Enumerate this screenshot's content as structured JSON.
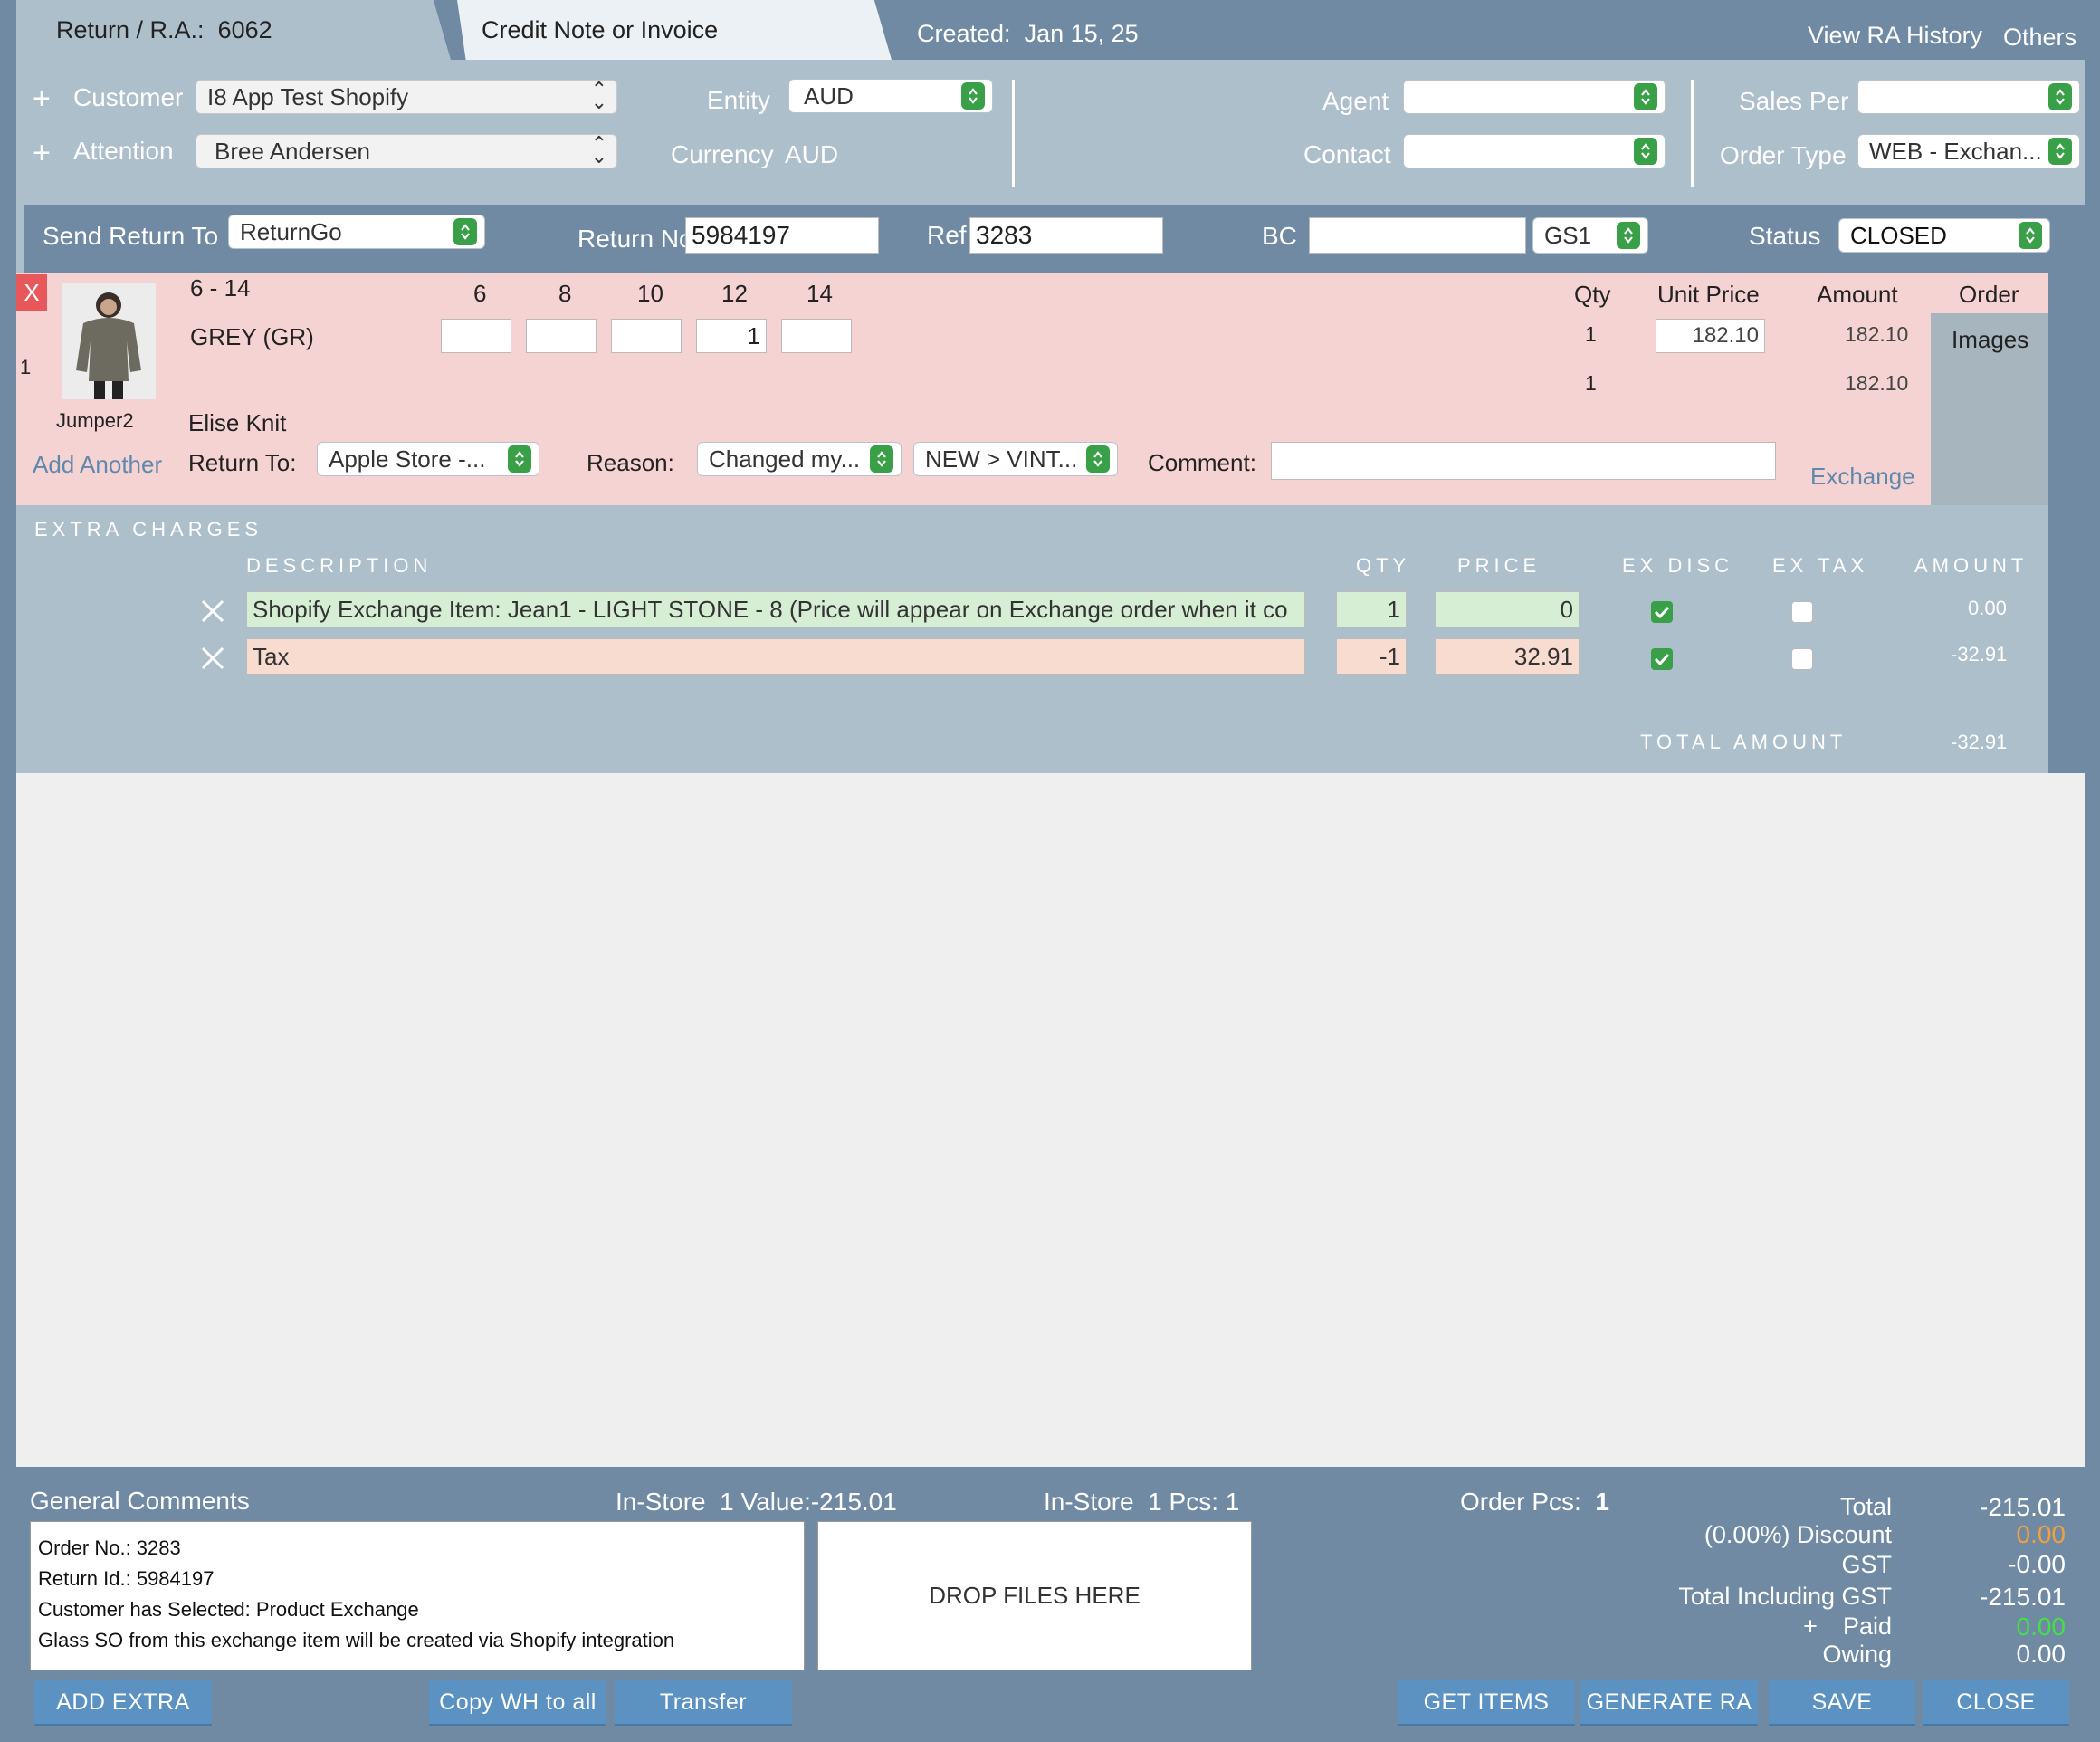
{
  "tabs": {
    "return_ra_label": "Return / R.A.:",
    "return_ra_number": "6062",
    "credit_tab": "Credit Note or Invoice",
    "created_label": "Created:",
    "created_date": "Jan 15, 25",
    "view_ra_history": "View RA History",
    "others": "Others"
  },
  "header": {
    "customer_label": "Customer",
    "customer_value": "I8 App Test Shopify",
    "attention_label": "Attention",
    "attention_value": "Bree Andersen",
    "entity_label": "Entity",
    "entity_value": "AUD",
    "currency_label": "Currency",
    "currency_value": "AUD",
    "agent_label": "Agent",
    "agent_value": "",
    "contact_label": "Contact",
    "contact_value": "",
    "sales_per_label": "Sales Per",
    "sales_per_value": "",
    "order_type_label": "Order Type",
    "order_type_value": "WEB - Exchan..."
  },
  "return_bar": {
    "send_return_to_label": "Send Return To",
    "send_return_to_value": "ReturnGo",
    "return_no_label": "Return No",
    "return_no_value": "5984197",
    "ref_label": "Ref",
    "ref_value": "3283",
    "bc_label": "BC",
    "bc_value": "",
    "gs1_value": "GS1",
    "status_label": "Status",
    "status_value": "CLOSED"
  },
  "item": {
    "remove": "X",
    "row_number": "1",
    "size_range": "6 - 14",
    "sizes": [
      "6",
      "8",
      "10",
      "12",
      "14"
    ],
    "size_qty": [
      "",
      "",
      "",
      "1",
      ""
    ],
    "color": "GREY (GR)",
    "sku": "Jumper2",
    "name": "Elise Knit",
    "qty_header": "Qty",
    "unit_price_header": "Unit Price",
    "amount_header": "Amount",
    "order_header": "Order",
    "qty": "1",
    "unit_price": "182.10",
    "amount": "182.10",
    "total_qty": "1",
    "total_amount": "182.10",
    "images_label": "Images",
    "add_another": "Add Another",
    "return_to_label": "Return To:",
    "return_to_value": "Apple Store -...",
    "reason_label": "Reason:",
    "reason_value": "Changed my...",
    "reason2_value": "NEW > VINT...",
    "comment_label": "Comment:",
    "comment_value": "",
    "exchange_label": "Exchange"
  },
  "extra": {
    "title": "EXTRA CHARGES",
    "headers": {
      "description": "DESCRIPTION",
      "qty": "QTY",
      "price": "PRICE",
      "ex_disc": "EX DISC",
      "ex_tax": "EX TAX",
      "amount": "AMOUNT"
    },
    "rows": [
      {
        "description": "Shopify Exchange Item: Jean1 - LIGHT STONE - 8 (Price will appear on Exchange order when it co",
        "qty": "1",
        "price": "0",
        "ex_disc": true,
        "ex_tax": false,
        "amount": "0.00"
      },
      {
        "description": "Tax",
        "qty": "-1",
        "price": "32.91",
        "ex_disc": true,
        "ex_tax": false,
        "amount": "-32.91"
      }
    ],
    "total_label": "TOTAL AMOUNT",
    "total_value": "-32.91"
  },
  "footer": {
    "general_comments_label": "General Comments",
    "instore_value_label": "In-Store",
    "instore_value_count": "1",
    "instore_value_text": "Value:",
    "instore_value": "-215.01",
    "instore_pcs_label": "In-Store",
    "instore_pcs_count": "1",
    "instore_pcs_text": "Pcs:",
    "instore_pcs": "1",
    "order_pcs_label": "Order Pcs:",
    "order_pcs_value": "1",
    "comments": [
      "Order No.: 3283",
      "Return Id.: 5984197",
      "Customer has Selected: Product Exchange",
      "Glass SO from this exchange item will be created via Shopify integration"
    ],
    "drop_files": "DROP FILES HERE",
    "totals": {
      "total_label": "Total",
      "total_value": "-215.01",
      "discount_label": "(0.00%) Discount",
      "discount_value": "0.00",
      "gst_label": "GST",
      "gst_value": "-0.00",
      "total_incl_label": "Total Including GST",
      "total_incl_value": "-215.01",
      "paid_label": "Paid",
      "paid_value": "0.00",
      "owing_label": "Owing",
      "owing_value": "0.00"
    },
    "buttons": {
      "add_extra": "ADD EXTRA",
      "copy_wh": "Copy WH to all",
      "transfer": "Transfer",
      "get_items": "GET ITEMS",
      "generate_ra": "GENERATE RA",
      "save": "SAVE",
      "close": "CLOSE"
    }
  },
  "colors": {
    "accent_green": "#39a047",
    "item_bg": "#f5d3d3",
    "header_bg": "#aebfcc",
    "button": "#5c92c1"
  }
}
